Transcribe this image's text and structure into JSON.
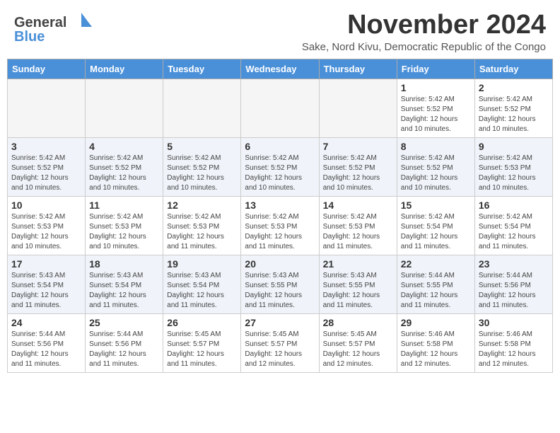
{
  "header": {
    "logo_general": "General",
    "logo_blue": "Blue",
    "month_title": "November 2024",
    "subtitle": "Sake, Nord Kivu, Democratic Republic of the Congo"
  },
  "calendar": {
    "weekdays": [
      "Sunday",
      "Monday",
      "Tuesday",
      "Wednesday",
      "Thursday",
      "Friday",
      "Saturday"
    ],
    "weeks": [
      [
        {
          "day": "",
          "info": ""
        },
        {
          "day": "",
          "info": ""
        },
        {
          "day": "",
          "info": ""
        },
        {
          "day": "",
          "info": ""
        },
        {
          "day": "",
          "info": ""
        },
        {
          "day": "1",
          "info": "Sunrise: 5:42 AM\nSunset: 5:52 PM\nDaylight: 12 hours\nand 10 minutes."
        },
        {
          "day": "2",
          "info": "Sunrise: 5:42 AM\nSunset: 5:52 PM\nDaylight: 12 hours\nand 10 minutes."
        }
      ],
      [
        {
          "day": "3",
          "info": "Sunrise: 5:42 AM\nSunset: 5:52 PM\nDaylight: 12 hours\nand 10 minutes."
        },
        {
          "day": "4",
          "info": "Sunrise: 5:42 AM\nSunset: 5:52 PM\nDaylight: 12 hours\nand 10 minutes."
        },
        {
          "day": "5",
          "info": "Sunrise: 5:42 AM\nSunset: 5:52 PM\nDaylight: 12 hours\nand 10 minutes."
        },
        {
          "day": "6",
          "info": "Sunrise: 5:42 AM\nSunset: 5:52 PM\nDaylight: 12 hours\nand 10 minutes."
        },
        {
          "day": "7",
          "info": "Sunrise: 5:42 AM\nSunset: 5:52 PM\nDaylight: 12 hours\nand 10 minutes."
        },
        {
          "day": "8",
          "info": "Sunrise: 5:42 AM\nSunset: 5:52 PM\nDaylight: 12 hours\nand 10 minutes."
        },
        {
          "day": "9",
          "info": "Sunrise: 5:42 AM\nSunset: 5:53 PM\nDaylight: 12 hours\nand 10 minutes."
        }
      ],
      [
        {
          "day": "10",
          "info": "Sunrise: 5:42 AM\nSunset: 5:53 PM\nDaylight: 12 hours\nand 10 minutes."
        },
        {
          "day": "11",
          "info": "Sunrise: 5:42 AM\nSunset: 5:53 PM\nDaylight: 12 hours\nand 10 minutes."
        },
        {
          "day": "12",
          "info": "Sunrise: 5:42 AM\nSunset: 5:53 PM\nDaylight: 12 hours\nand 11 minutes."
        },
        {
          "day": "13",
          "info": "Sunrise: 5:42 AM\nSunset: 5:53 PM\nDaylight: 12 hours\nand 11 minutes."
        },
        {
          "day": "14",
          "info": "Sunrise: 5:42 AM\nSunset: 5:53 PM\nDaylight: 12 hours\nand 11 minutes."
        },
        {
          "day": "15",
          "info": "Sunrise: 5:42 AM\nSunset: 5:54 PM\nDaylight: 12 hours\nand 11 minutes."
        },
        {
          "day": "16",
          "info": "Sunrise: 5:42 AM\nSunset: 5:54 PM\nDaylight: 12 hours\nand 11 minutes."
        }
      ],
      [
        {
          "day": "17",
          "info": "Sunrise: 5:43 AM\nSunset: 5:54 PM\nDaylight: 12 hours\nand 11 minutes."
        },
        {
          "day": "18",
          "info": "Sunrise: 5:43 AM\nSunset: 5:54 PM\nDaylight: 12 hours\nand 11 minutes."
        },
        {
          "day": "19",
          "info": "Sunrise: 5:43 AM\nSunset: 5:54 PM\nDaylight: 12 hours\nand 11 minutes."
        },
        {
          "day": "20",
          "info": "Sunrise: 5:43 AM\nSunset: 5:55 PM\nDaylight: 12 hours\nand 11 minutes."
        },
        {
          "day": "21",
          "info": "Sunrise: 5:43 AM\nSunset: 5:55 PM\nDaylight: 12 hours\nand 11 minutes."
        },
        {
          "day": "22",
          "info": "Sunrise: 5:44 AM\nSunset: 5:55 PM\nDaylight: 12 hours\nand 11 minutes."
        },
        {
          "day": "23",
          "info": "Sunrise: 5:44 AM\nSunset: 5:56 PM\nDaylight: 12 hours\nand 11 minutes."
        }
      ],
      [
        {
          "day": "24",
          "info": "Sunrise: 5:44 AM\nSunset: 5:56 PM\nDaylight: 12 hours\nand 11 minutes."
        },
        {
          "day": "25",
          "info": "Sunrise: 5:44 AM\nSunset: 5:56 PM\nDaylight: 12 hours\nand 11 minutes."
        },
        {
          "day": "26",
          "info": "Sunrise: 5:45 AM\nSunset: 5:57 PM\nDaylight: 12 hours\nand 11 minutes."
        },
        {
          "day": "27",
          "info": "Sunrise: 5:45 AM\nSunset: 5:57 PM\nDaylight: 12 hours\nand 12 minutes."
        },
        {
          "day": "28",
          "info": "Sunrise: 5:45 AM\nSunset: 5:57 PM\nDaylight: 12 hours\nand 12 minutes."
        },
        {
          "day": "29",
          "info": "Sunrise: 5:46 AM\nSunset: 5:58 PM\nDaylight: 12 hours\nand 12 minutes."
        },
        {
          "day": "30",
          "info": "Sunrise: 5:46 AM\nSunset: 5:58 PM\nDaylight: 12 hours\nand 12 minutes."
        }
      ]
    ]
  }
}
